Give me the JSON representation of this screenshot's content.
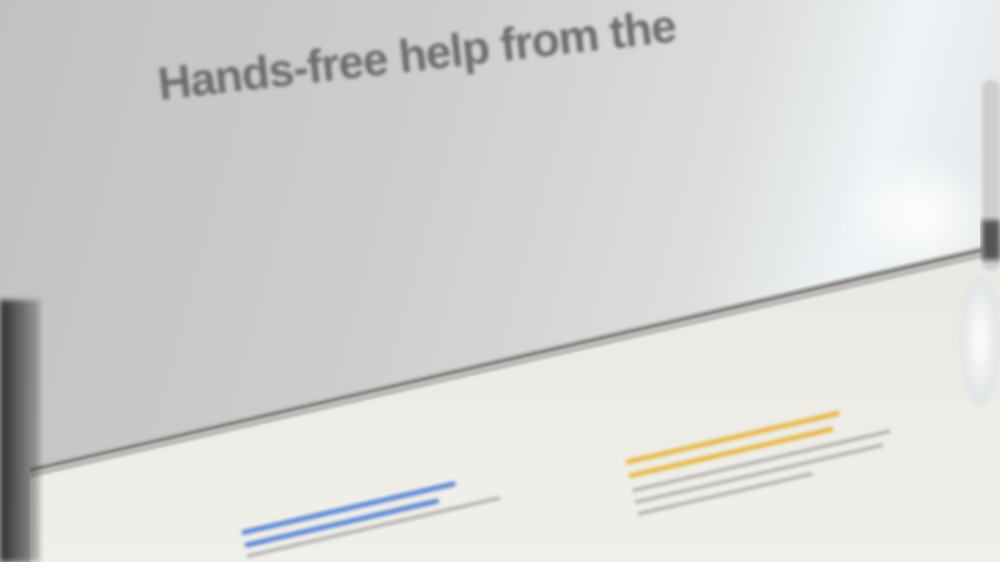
{
  "display": {
    "headline": "Hands-free help from the",
    "colors": {
      "yellow_heading": "#e8b84a",
      "blue_heading": "#5a86d6",
      "body_text": "#9a9a9a"
    }
  }
}
